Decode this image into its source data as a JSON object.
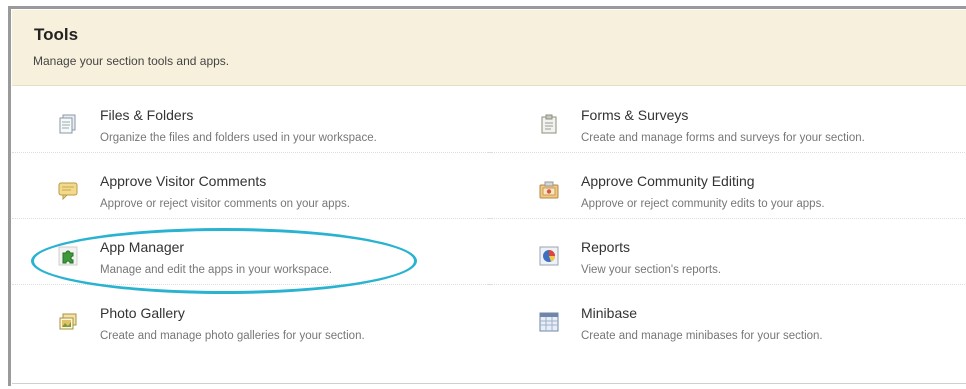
{
  "header": {
    "title": "Tools",
    "subtitle": "Manage your section tools and apps."
  },
  "tools": [
    {
      "name": "Files & Folders",
      "description": "Organize the files and folders used in your workspace.",
      "icon": "files-folders-icon"
    },
    {
      "name": "Forms & Surveys",
      "description": "Create and manage forms and surveys for your section.",
      "icon": "clipboard-icon"
    },
    {
      "name": "Approve Visitor Comments",
      "description": "Approve or reject visitor comments on your apps.",
      "icon": "comment-bubble-icon"
    },
    {
      "name": "Approve Community Editing",
      "description": "Approve or reject community edits to your apps.",
      "icon": "community-edit-icon"
    },
    {
      "name": "App Manager",
      "description": "Manage and edit the apps in your workspace.",
      "icon": "puzzle-piece-icon"
    },
    {
      "name": "Reports",
      "description": "View your section's reports.",
      "icon": "pie-chart-icon"
    },
    {
      "name": "Photo Gallery",
      "description": "Create and manage photo galleries for your section.",
      "icon": "photo-gallery-icon"
    },
    {
      "name": "Minibase",
      "description": "Create and manage minibases for your section.",
      "icon": "minibase-table-icon"
    }
  ],
  "colors": {
    "header_bg": "#f6f0dc",
    "highlight": "#29b3d0"
  }
}
